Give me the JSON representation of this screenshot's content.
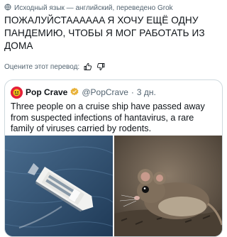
{
  "translation": {
    "icon": "globe-icon",
    "note": "Исходный язык — английский, переведено Grok"
  },
  "post": {
    "text": "ПОЖАЛУЙСТААААAA Я ХОЧУ ЕЩЁ ОДНУ ПАНДЕМИЮ, ЧТОБЫ Я МОГ РАБОТАТЬ ИЗ ДОМА"
  },
  "rating": {
    "label": "Оцените этот перевод:",
    "like_icon": "thumbs-up-icon",
    "dislike_icon": "thumbs-down-icon"
  },
  "quote": {
    "name": "Pop Crave",
    "handle": "@PopCrave",
    "separator": "·",
    "time": "3 дн.",
    "text": "Three people on a cruise ship have passed away from suspected infections of hantavirus, a rare family of viruses carried by rodents.",
    "verified_color": "#e8b23a",
    "media": [
      "cruise-ship-photo",
      "mouse-photo"
    ]
  }
}
